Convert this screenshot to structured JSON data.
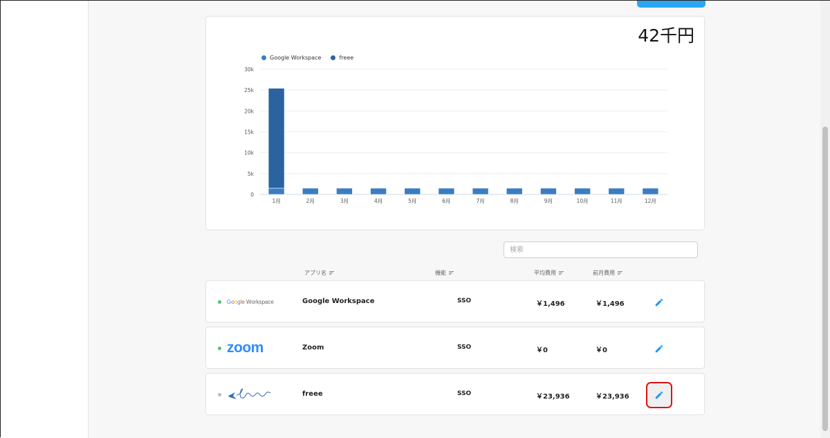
{
  "summary": {
    "total": "42千円"
  },
  "chart_data": {
    "type": "bar",
    "categories": [
      "1月",
      "2月",
      "3月",
      "4月",
      "5月",
      "6月",
      "7月",
      "8月",
      "9月",
      "10月",
      "11月",
      "12月"
    ],
    "series": [
      {
        "name": "Google Workspace",
        "color": "#3a7dc2",
        "values": [
          1496,
          1496,
          1496,
          1496,
          1496,
          1496,
          1496,
          1496,
          1496,
          1496,
          1496,
          1496
        ]
      },
      {
        "name": "freee",
        "color": "#2a63a0",
        "values": [
          23936,
          0,
          0,
          0,
          0,
          0,
          0,
          0,
          0,
          0,
          0,
          0
        ]
      }
    ],
    "stacked": true,
    "ylim": [
      0,
      30000
    ],
    "yticks": [
      "0",
      "5k",
      "10k",
      "15k",
      "20k",
      "25k",
      "30k"
    ],
    "yticks_values": [
      0,
      5000,
      10000,
      15000,
      20000,
      25000,
      30000
    ],
    "grid": true,
    "legend": "top-left"
  },
  "search": {
    "placeholder": "検索"
  },
  "table": {
    "headers": {
      "app": "アプリ名",
      "feature": "機能",
      "avg": "平均費用",
      "prev": "前月費用"
    },
    "rows": [
      {
        "logo": "Google Workspace",
        "logo_icon": "google-workspace-logo",
        "name": "Google Workspace",
        "feature": "SSO",
        "avg": "￥1,496",
        "prev": "￥1,496",
        "status_color": "#4cc46a"
      },
      {
        "logo": "zoom",
        "logo_icon": "zoom-logo",
        "name": "Zoom",
        "feature": "SSO",
        "avg": "￥0",
        "prev": "￥0",
        "status_color": "#4cc46a"
      },
      {
        "logo": "freee",
        "logo_icon": "freee-logo",
        "name": "freee",
        "feature": "SSO",
        "avg": "￥23,936",
        "prev": "￥23,936",
        "status_color": "#bbbbbb"
      }
    ]
  }
}
